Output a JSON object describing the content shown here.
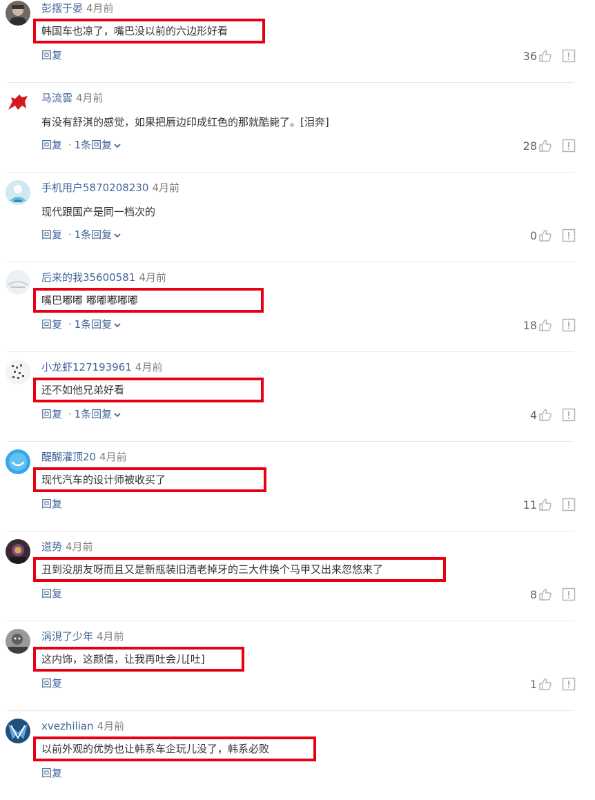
{
  "comments": [
    {
      "username": "彭摆于晏",
      "time": "4月前",
      "text": "韩国车也凉了，嘴巴没以前的六边形好看",
      "reply_label": "回复",
      "replies_label": "",
      "likes": "36",
      "highlighted": true,
      "box_width": 336
    },
    {
      "username": "马流雲",
      "time": "4月前",
      "text": "有没有舒淇的感觉，如果把唇边印成红色的那就酷毙了。[泪奔]",
      "reply_label": "回复",
      "replies_label": "1条回复",
      "likes": "28",
      "highlighted": false,
      "box_width": 0
    },
    {
      "username": "手机用户5870208230",
      "time": "4月前",
      "text": "现代跟国产是同一档次的",
      "reply_label": "回复",
      "replies_label": "1条回复",
      "likes": "0",
      "highlighted": false,
      "box_width": 0
    },
    {
      "username": "后来的我35600581",
      "time": "4月前",
      "text": "嘴巴嘟嘟 嘟嘟嘟嘟嘟",
      "reply_label": "回复",
      "replies_label": "1条回复",
      "likes": "18",
      "highlighted": true,
      "box_width": 334
    },
    {
      "username": "小龙虾127193961",
      "time": "4月前",
      "text": "还不如他兄弟好看",
      "reply_label": "回复",
      "replies_label": "1条回复",
      "likes": "4",
      "highlighted": true,
      "box_width": 334
    },
    {
      "username": "醍醐灌顶20",
      "time": "4月前",
      "text": "现代汽车的设计师被收买了",
      "reply_label": "回复",
      "replies_label": "",
      "likes": "11",
      "highlighted": true,
      "box_width": 338
    },
    {
      "username": "道势",
      "time": "4月前",
      "text": "丑到没朋友呀而且又是新瓶装旧酒老掉牙的三大件换个马甲又出来忽悠来了",
      "reply_label": "回复",
      "replies_label": "",
      "likes": "8",
      "highlighted": true,
      "box_width": 598
    },
    {
      "username": "涡涀了少年",
      "time": "4月前",
      "text": "这内饰，这颜值，让我再吐会儿[吐]",
      "reply_label": "回复",
      "replies_label": "",
      "likes": "1",
      "highlighted": true,
      "box_width": 306
    },
    {
      "username": "xvezhilian",
      "time": "4月前",
      "text": "以前外观的优势也让韩系车企玩儿没了，韩系必败",
      "reply_label": "回复",
      "replies_label": "",
      "likes": "",
      "highlighted": true,
      "box_width": 410
    }
  ],
  "colors": {
    "username": "#406599",
    "time": "#808080",
    "highlight_border": "#e60012",
    "icon": "#b3b3b3"
  },
  "icons": {
    "like": "thumbs-up-icon",
    "report": "report-icon",
    "expand": "chevron-down-icon"
  }
}
